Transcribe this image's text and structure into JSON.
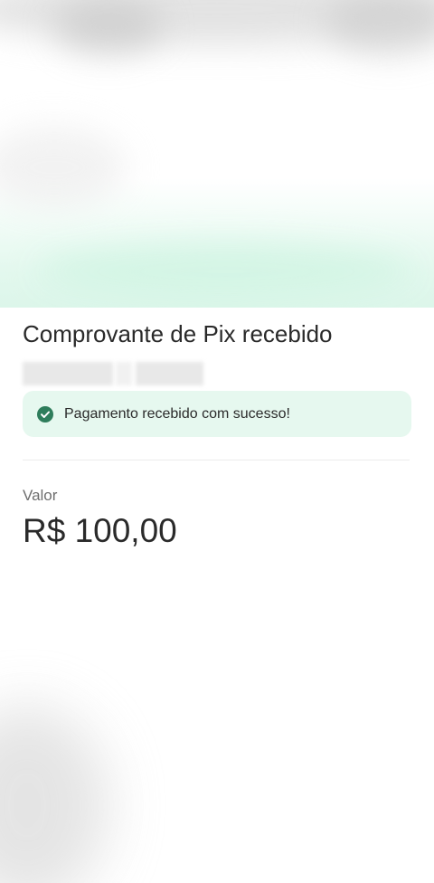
{
  "receipt": {
    "title": "Comprovante de Pix recebido",
    "status_message": "Pagamento recebido com sucesso!",
    "value_label": "Valor",
    "value_amount": "R$ 100,00"
  },
  "icons": {
    "status": "check-circle-icon"
  },
  "colors": {
    "success_background": "#e6f8ef",
    "success_icon": "#2e7d5b",
    "text_primary": "#2a2a2a",
    "text_secondary": "#6e6e6e"
  }
}
